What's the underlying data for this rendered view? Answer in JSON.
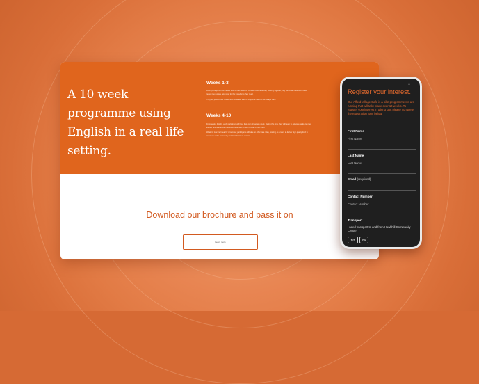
{
  "hero": {
    "title": "A 10 week programme using English in a real life setting.",
    "sections": [
      {
        "heading": "Weeks 1-3",
        "paragraphs": [
          "Learn participants will choose from of their favourite Konnect cuisine dishes, working together, they will create their own menu, review the recipes, and shop for the ingredients they need.",
          "They will perfect their dishes and showcase them at a special menu in the Village Café."
        ]
      },
      {
        "heading": "Weeks 4-10",
        "paragraphs": [
          "From weeks 4 to 10, each participant will have their own showcase week. During this time, they will learn to delegate tasks, run the kitchen and market their dishes to be served at the Thursday Lunch Club.",
          "Week 10 is a final meal for showcase; participants will take on other cafe roles, working as a team to deliver high quality food to members of the community and local business owners."
        ]
      }
    ]
  },
  "download": {
    "title": "Download  our brochure and pass it on",
    "button_label": "Learn more"
  },
  "phone": {
    "status": "•••",
    "title": "Register your interest.",
    "description": "Our Alfield Village Cafe is a pilot programme we are running that will take place over 10 weeks. To register your interest in taking part please complete the registration form below.",
    "fields": [
      {
        "label": "First Name",
        "placeholder": "First Name"
      },
      {
        "label": "Last Name",
        "placeholder": "Last Name"
      },
      {
        "label": "Email",
        "required": "(required)"
      },
      {
        "label": "Contact Number",
        "placeholder": "Contact Number"
      }
    ],
    "transport": {
      "label": "Transport",
      "text": "I need transport to and from Hawkhill Community Centre",
      "yes": "Yes",
      "no": "No"
    }
  },
  "colors": {
    "accent": "#e0651d",
    "background": "#d66a34",
    "phone_bg": "#1f1f1f"
  }
}
